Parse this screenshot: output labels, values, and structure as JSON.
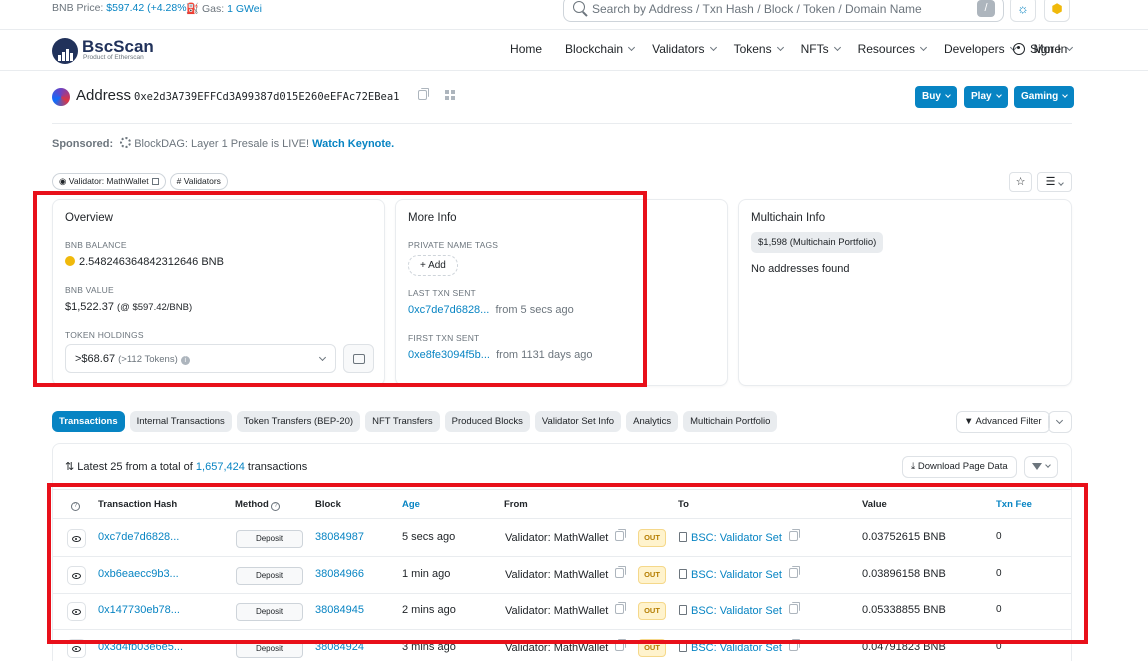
{
  "topbar": {
    "price_label": "BNB Price:",
    "price_value": "$597.42",
    "price_change": "(+4.28%)",
    "gas_label": "Gas:",
    "gas_value": "1 GWei",
    "search_placeholder": "Search by Address / Txn Hash / Block / Token / Domain Name",
    "search_shortcut": "/"
  },
  "header": {
    "logo_name": "BscScan",
    "logo_sub": "Product of Etherscan",
    "nav": [
      "Home",
      "Blockchain",
      "Validators",
      "Tokens",
      "NFTs",
      "Resources",
      "Developers",
      "More"
    ],
    "nav_dropdown": [
      false,
      true,
      true,
      true,
      true,
      true,
      true,
      true
    ],
    "signin": "Sign In"
  },
  "address": {
    "title": "Address",
    "hash": "0xe2d3A739EFFCd3A99387d015E260eEFAc72EBea1",
    "buttons": [
      "Buy",
      "Play",
      "Gaming"
    ]
  },
  "sponsored": {
    "label": "Sponsored:",
    "brand": "BlockDAG:",
    "text": "Layer 1 Presale is LIVE!",
    "link": "Watch Keynote."
  },
  "tags": [
    "Validator: MathWallet",
    "# Validators"
  ],
  "overview": {
    "title": "Overview",
    "balance_label": "BNB BALANCE",
    "balance_value": "2.548246364842312646 BNB",
    "value_label": "BNB VALUE",
    "value_value": "$1,522.37",
    "value_rate": "(@ $597.42/BNB)",
    "holdings_label": "TOKEN HOLDINGS",
    "holdings_value": ">$68.67",
    "holdings_count": "(>112 Tokens)"
  },
  "more_info": {
    "title": "More Info",
    "tags_label": "PRIVATE NAME TAGS",
    "add_label": "+ Add",
    "last_label": "LAST TXN SENT",
    "last_hash": "0xc7de7d6828...",
    "last_time": "from 5 secs ago",
    "first_label": "FIRST TXN SENT",
    "first_hash": "0xe8fe3094f5b...",
    "first_time": "from 1131 days ago"
  },
  "multichain": {
    "title": "Multichain Info",
    "badge_value": "$1,598",
    "badge_text": "(Multichain Portfolio)",
    "empty": "No addresses found"
  },
  "tabs": [
    "Transactions",
    "Internal Transactions",
    "Token Transfers (BEP-20)",
    "NFT Transfers",
    "Produced Blocks",
    "Validator Set Info",
    "Analytics",
    "Multichain Portfolio"
  ],
  "active_tab": 0,
  "advanced_filter": "Advanced Filter",
  "txns": {
    "summary_prefix": "Latest 25 from a total of",
    "summary_total": "1,657,424",
    "summary_suffix": "transactions",
    "download": "Download Page Data",
    "columns": [
      "Transaction Hash",
      "Method",
      "Block",
      "Age",
      "From",
      "To",
      "Value",
      "Txn Fee"
    ],
    "rows": [
      {
        "hash": "0xc7de7d6828...",
        "method": "Deposit",
        "block": "38084987",
        "age": "5 secs ago",
        "from": "Validator: MathWallet",
        "dir": "OUT",
        "to": "BSC: Validator Set",
        "value": "0.03752615 BNB",
        "fee": "0"
      },
      {
        "hash": "0xb6eaecc9b3...",
        "method": "Deposit",
        "block": "38084966",
        "age": "1 min ago",
        "from": "Validator: MathWallet",
        "dir": "OUT",
        "to": "BSC: Validator Set",
        "value": "0.03896158 BNB",
        "fee": "0"
      },
      {
        "hash": "0x147730eb78...",
        "method": "Deposit",
        "block": "38084945",
        "age": "2 mins ago",
        "from": "Validator: MathWallet",
        "dir": "OUT",
        "to": "BSC: Validator Set",
        "value": "0.05338855 BNB",
        "fee": "0"
      },
      {
        "hash": "0x3d4fb03e6e5...",
        "method": "Deposit",
        "block": "38084924",
        "age": "3 mins ago",
        "from": "Validator: MathWallet",
        "dir": "OUT",
        "to": "BSC: Validator Set",
        "value": "0.04791823 BNB",
        "fee": "0"
      }
    ]
  },
  "colors": {
    "accent": "#0784c3",
    "highlight": "#e8101a",
    "out_badge": "#fff3cd",
    "coin": "#f0b90b"
  }
}
